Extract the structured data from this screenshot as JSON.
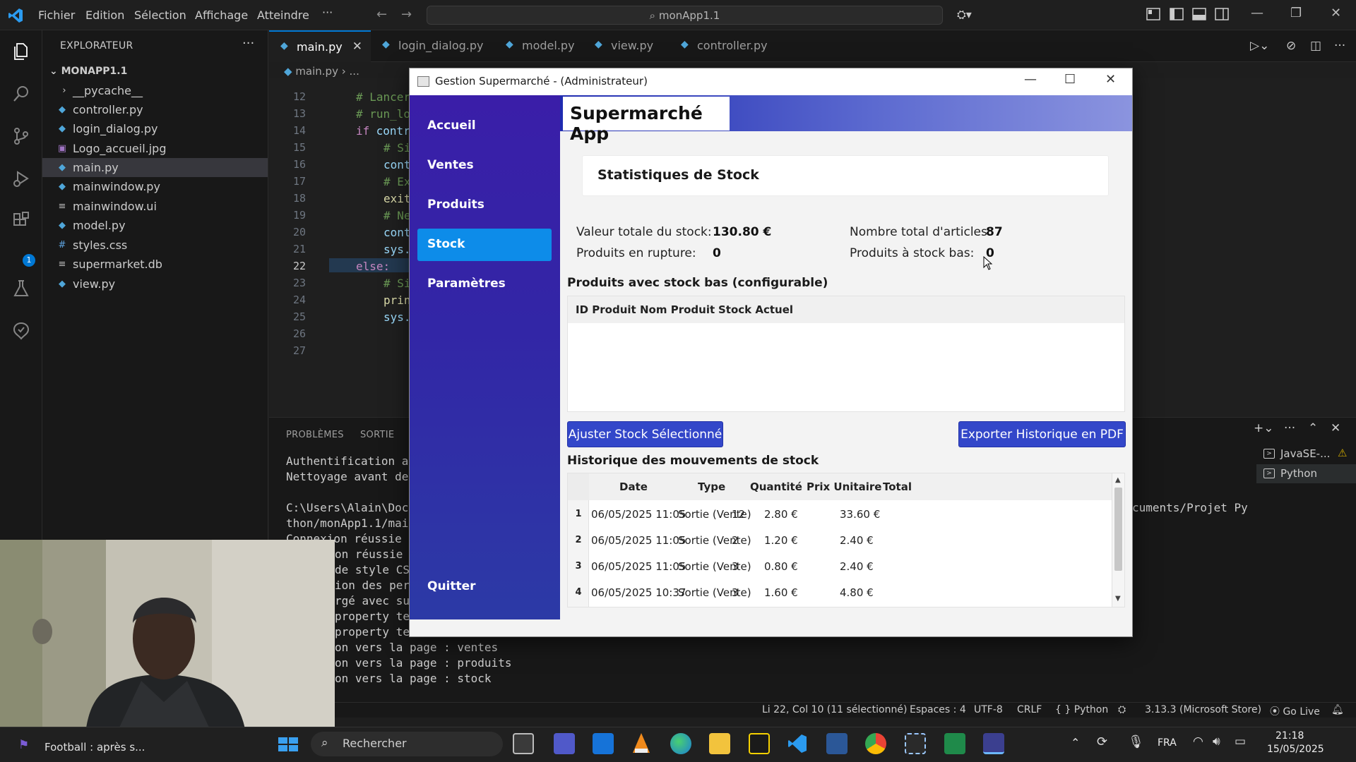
{
  "titlebar": {
    "menu": [
      "Fichier",
      "Edition",
      "Sélection",
      "Affichage",
      "Atteindre",
      "···"
    ],
    "search": "monApp1.1"
  },
  "explorer": {
    "header": "EXPLORATEUR",
    "more": "···",
    "root": "MONAPP1.1",
    "files": [
      {
        "name": "__pycache__",
        "icon": "chevron-right-icon"
      },
      {
        "name": "controller.py",
        "icon": "python-file-icon"
      },
      {
        "name": "login_dialog.py",
        "icon": "python-file-icon"
      },
      {
        "name": "Logo_accueil.jpg",
        "icon": "image-file-icon"
      },
      {
        "name": "main.py",
        "icon": "python-file-icon"
      },
      {
        "name": "mainwindow.py",
        "icon": "python-file-icon"
      },
      {
        "name": "mainwindow.ui",
        "icon": "text-file-icon"
      },
      {
        "name": "model.py",
        "icon": "python-file-icon"
      },
      {
        "name": "styles.css",
        "icon": "css-file-icon"
      },
      {
        "name": "supermarket.db",
        "icon": "text-file-icon"
      },
      {
        "name": "view.py",
        "icon": "python-file-icon"
      }
    ]
  },
  "tabs": [
    {
      "label": "main.py"
    },
    {
      "label": "login_dialog.py"
    },
    {
      "label": "model.py"
    },
    {
      "label": "view.py"
    },
    {
      "label": "controller.py"
    }
  ],
  "breadcrumb": {
    "file": "main.py",
    "rest": "..."
  },
  "editor": {
    "line_numbers": [
      "12",
      "13",
      "14",
      "15",
      "16",
      "17",
      "18",
      "19",
      "20",
      "21",
      "22",
      "23",
      "24",
      "25",
      "26",
      "27"
    ],
    "fragments": {
      "l12": "# Lancer",
      "l13": "# run_lo",
      "l14a": "if",
      "l14b": " contr",
      "l15": "# Si",
      "l16": "cont",
      "l17": "# Ex",
      "l18": "exit",
      "l19": "# Ne",
      "l20": "cont",
      "l21": "sys.",
      "l22": "else:",
      "l23": "# Si",
      "l24": "prin",
      "l25": "sys."
    }
  },
  "panel": {
    "tabs": [
      "PROBLÈMES",
      "SORTIE"
    ],
    "terminal_lines": [
      "Authentification an",
      "Nettoyage avant de ",
      "",
      "C:\\Users\\Alain\\Docu",
      "thon/monApp1.1/main",
      "Connexion réussie p",
      "on réussie a",
      "de style CS",
      "ion des per",
      "rgé avec su",
      "property te",
      "property te",
      "on vers la page : ventes",
      "on vers la page : produits",
      "on vers la page : stock"
    ],
    "path_tail": "cuments/Projet Py",
    "terminals": [
      "JavaSE-...",
      "Python"
    ]
  },
  "statusbar": {
    "position": "Li 22, Col 10 (11 sélectionné)",
    "spaces": "Espaces : 4",
    "encoding": "UTF-8",
    "eol": "CRLF",
    "language": "{ } Python",
    "interpreter": "3.13.3 (Microsoft Store)",
    "golive": "Go Live"
  },
  "taskbar": {
    "news": "Football : après s...",
    "search_placeholder": "Rechercher",
    "lang": "FRA",
    "time": "21:18",
    "date": "15/05/2025"
  },
  "app": {
    "window_title": "Gestion Supermarché - (Administrateur)",
    "header_title": "Supermarché App",
    "nav": [
      "Accueil",
      "Ventes",
      "Produits",
      "Stock",
      "Paramètres"
    ],
    "nav_active": "Stock",
    "quit": "Quitter",
    "stats_title": "Statistiques de Stock",
    "stats": {
      "total_value_label": "Valeur totale du stock:",
      "total_value": "130.80 €",
      "rupture_label": "Produits en rupture:",
      "rupture": "0",
      "total_items_label": "Nombre total d'articles:",
      "total_items": "87",
      "low_stock_label": "Produits à stock bas:",
      "low_stock": "0"
    },
    "low_stock_title": "Produits avec stock bas (configurable)",
    "low_stock_columns": [
      "ID Produit",
      "Nom Produit",
      "Stock Actuel"
    ],
    "adjust_button": "Ajuster Stock Sélectionné",
    "export_button": "Exporter Historique en PDF",
    "history_title": "Historique des mouvements de stock",
    "history_columns": [
      "Date",
      "Type",
      "Quantité",
      "Prix Unitaire",
      "Total"
    ],
    "history_rows": [
      {
        "n": "1",
        "date": "06/05/2025 11:05",
        "type": "Sortie (Vente)",
        "qty": "12",
        "price": "2.80 €",
        "total": "33.60 €"
      },
      {
        "n": "2",
        "date": "06/05/2025 11:05",
        "type": "Sortie (Vente)",
        "qty": "2",
        "price": "1.20 €",
        "total": "2.40 €"
      },
      {
        "n": "3",
        "date": "06/05/2025 11:05",
        "type": "Sortie (Vente)",
        "qty": "3",
        "price": "0.80 €",
        "total": "2.40 €"
      },
      {
        "n": "4",
        "date": "06/05/2025 10:37",
        "type": "Sortie (Vente)",
        "qty": "3",
        "price": "1.60 €",
        "total": "4.80 €"
      }
    ]
  }
}
